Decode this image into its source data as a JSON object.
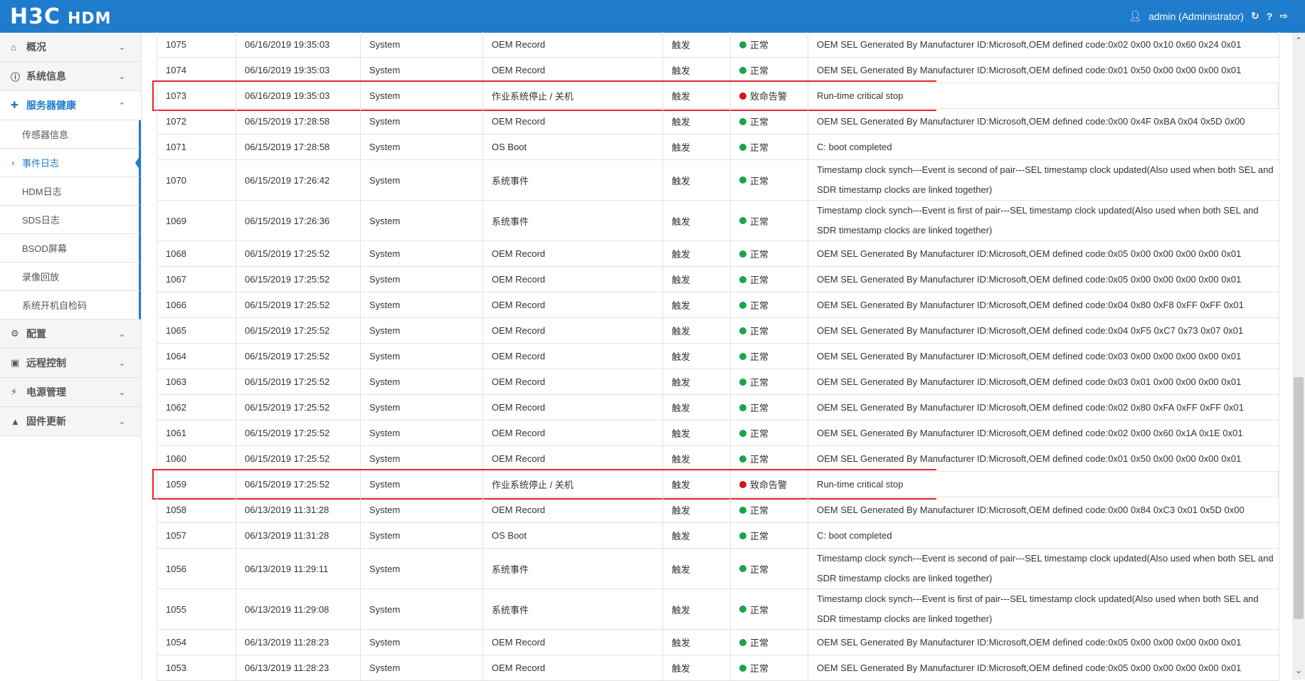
{
  "header": {
    "logo": "H3C",
    "product": "HDM",
    "user": "admin (Administrator)"
  },
  "sidebar": {
    "groups_top": [
      {
        "label": "概况",
        "icon": "home-icon"
      },
      {
        "label": "系统信息",
        "icon": "info-icon"
      }
    ],
    "open_group": {
      "label": "服务器健康",
      "icon": "health-icon"
    },
    "sub_items": [
      {
        "label": "传感器信息"
      },
      {
        "label": "事件日志",
        "active": true
      },
      {
        "label": "HDM日志"
      },
      {
        "label": "SDS日志"
      },
      {
        "label": "BSOD屏幕"
      },
      {
        "label": "录像回放"
      },
      {
        "label": "系统开机自检码"
      }
    ],
    "groups_bottom": [
      {
        "label": "配置",
        "icon": "gear-icon"
      },
      {
        "label": "远程控制",
        "icon": "remote-icon"
      },
      {
        "label": "电源管理",
        "icon": "power-icon"
      },
      {
        "label": "固件更新",
        "icon": "firmware-icon"
      }
    ]
  },
  "colors": {
    "normal": "#1aa34a",
    "critical": "#d0141a",
    "accent": "#1f7bcb"
  },
  "events": [
    {
      "id": "1075",
      "time": "06/16/2019 19:35:03",
      "type": "System",
      "sensor": "OEM Record",
      "trigger": "触发",
      "status": "正常",
      "level": "normal",
      "desc": "OEM SEL Generated By Manufacturer ID:Microsoft,OEM defined code:0x02 0x00 0x10 0x60 0x24 0x01"
    },
    {
      "id": "1074",
      "time": "06/16/2019 19:35:03",
      "type": "System",
      "sensor": "OEM Record",
      "trigger": "触发",
      "status": "正常",
      "level": "normal",
      "desc": "OEM SEL Generated By Manufacturer ID:Microsoft,OEM defined code:0x01 0x50 0x00 0x00 0x00 0x01"
    },
    {
      "id": "1073",
      "time": "06/16/2019 19:35:03",
      "type": "System",
      "sensor": "作业系统停止 / 关机",
      "trigger": "触发",
      "status": "致命告警",
      "level": "critical",
      "desc": "Run-time critical stop",
      "highlight": true
    },
    {
      "id": "1072",
      "time": "06/15/2019 17:28:58",
      "type": "System",
      "sensor": "OEM Record",
      "trigger": "触发",
      "status": "正常",
      "level": "normal",
      "desc": "OEM SEL Generated By Manufacturer ID:Microsoft,OEM defined code:0x00 0x4F 0xBA 0x04 0x5D 0x00"
    },
    {
      "id": "1071",
      "time": "06/15/2019 17:28:58",
      "type": "System",
      "sensor": "OS Boot",
      "trigger": "触发",
      "status": "正常",
      "level": "normal",
      "desc": "C: boot completed"
    },
    {
      "id": "1070",
      "time": "06/15/2019 17:26:42",
      "type": "System",
      "sensor": "系统事件",
      "trigger": "触发",
      "status": "正常",
      "level": "normal",
      "desc": "Timestamp clock synch---Event is second of pair---SEL timestamp clock updated(Also used when both SEL and SDR timestamp clocks are linked together)",
      "tall": true
    },
    {
      "id": "1069",
      "time": "06/15/2019 17:26:36",
      "type": "System",
      "sensor": "系统事件",
      "trigger": "触发",
      "status": "正常",
      "level": "normal",
      "desc": "Timestamp clock synch---Event is first of pair---SEL timestamp clock updated(Also used when both SEL and SDR timestamp clocks are linked together)",
      "tall": true
    },
    {
      "id": "1068",
      "time": "06/15/2019 17:25:52",
      "type": "System",
      "sensor": "OEM Record",
      "trigger": "触发",
      "status": "正常",
      "level": "normal",
      "desc": "OEM SEL Generated By Manufacturer ID:Microsoft,OEM defined code:0x05 0x00 0x00 0x00 0x00 0x01"
    },
    {
      "id": "1067",
      "time": "06/15/2019 17:25:52",
      "type": "System",
      "sensor": "OEM Record",
      "trigger": "触发",
      "status": "正常",
      "level": "normal",
      "desc": "OEM SEL Generated By Manufacturer ID:Microsoft,OEM defined code:0x05 0x00 0x00 0x00 0x00 0x01"
    },
    {
      "id": "1066",
      "time": "06/15/2019 17:25:52",
      "type": "System",
      "sensor": "OEM Record",
      "trigger": "触发",
      "status": "正常",
      "level": "normal",
      "desc": "OEM SEL Generated By Manufacturer ID:Microsoft,OEM defined code:0x04 0x80 0xF8 0xFF 0xFF 0x01"
    },
    {
      "id": "1065",
      "time": "06/15/2019 17:25:52",
      "type": "System",
      "sensor": "OEM Record",
      "trigger": "触发",
      "status": "正常",
      "level": "normal",
      "desc": "OEM SEL Generated By Manufacturer ID:Microsoft,OEM defined code:0x04 0xF5 0xC7 0x73 0x07 0x01"
    },
    {
      "id": "1064",
      "time": "06/15/2019 17:25:52",
      "type": "System",
      "sensor": "OEM Record",
      "trigger": "触发",
      "status": "正常",
      "level": "normal",
      "desc": "OEM SEL Generated By Manufacturer ID:Microsoft,OEM defined code:0x03 0x00 0x00 0x00 0x00 0x01"
    },
    {
      "id": "1063",
      "time": "06/15/2019 17:25:52",
      "type": "System",
      "sensor": "OEM Record",
      "trigger": "触发",
      "status": "正常",
      "level": "normal",
      "desc": "OEM SEL Generated By Manufacturer ID:Microsoft,OEM defined code:0x03 0x01 0x00 0x00 0x00 0x01"
    },
    {
      "id": "1062",
      "time": "06/15/2019 17:25:52",
      "type": "System",
      "sensor": "OEM Record",
      "trigger": "触发",
      "status": "正常",
      "level": "normal",
      "desc": "OEM SEL Generated By Manufacturer ID:Microsoft,OEM defined code:0x02 0x80 0xFA 0xFF 0xFF 0x01"
    },
    {
      "id": "1061",
      "time": "06/15/2019 17:25:52",
      "type": "System",
      "sensor": "OEM Record",
      "trigger": "触发",
      "status": "正常",
      "level": "normal",
      "desc": "OEM SEL Generated By Manufacturer ID:Microsoft,OEM defined code:0x02 0x00 0x60 0x1A 0x1E 0x01"
    },
    {
      "id": "1060",
      "time": "06/15/2019 17:25:52",
      "type": "System",
      "sensor": "OEM Record",
      "trigger": "触发",
      "status": "正常",
      "level": "normal",
      "desc": "OEM SEL Generated By Manufacturer ID:Microsoft,OEM defined code:0x01 0x50 0x00 0x00 0x00 0x01"
    },
    {
      "id": "1059",
      "time": "06/15/2019 17:25:52",
      "type": "System",
      "sensor": "作业系统停止 / 关机",
      "trigger": "触发",
      "status": "致命告警",
      "level": "critical",
      "desc": "Run-time critical stop",
      "highlight": true
    },
    {
      "id": "1058",
      "time": "06/13/2019 11:31:28",
      "type": "System",
      "sensor": "OEM Record",
      "trigger": "触发",
      "status": "正常",
      "level": "normal",
      "desc": "OEM SEL Generated By Manufacturer ID:Microsoft,OEM defined code:0x00 0x84 0xC3 0x01 0x5D 0x00"
    },
    {
      "id": "1057",
      "time": "06/13/2019 11:31:28",
      "type": "System",
      "sensor": "OS Boot",
      "trigger": "触发",
      "status": "正常",
      "level": "normal",
      "desc": "C: boot completed"
    },
    {
      "id": "1056",
      "time": "06/13/2019 11:29:11",
      "type": "System",
      "sensor": "系统事件",
      "trigger": "触发",
      "status": "正常",
      "level": "normal",
      "desc": "Timestamp clock synch---Event is second of pair---SEL timestamp clock updated(Also used when both SEL and SDR timestamp clocks are linked together)",
      "tall": true
    },
    {
      "id": "1055",
      "time": "06/13/2019 11:29:08",
      "type": "System",
      "sensor": "系统事件",
      "trigger": "触发",
      "status": "正常",
      "level": "normal",
      "desc": "Timestamp clock synch---Event is first of pair---SEL timestamp clock updated(Also used when both SEL and SDR timestamp clocks are linked together)",
      "tall": true
    },
    {
      "id": "1054",
      "time": "06/13/2019 11:28:23",
      "type": "System",
      "sensor": "OEM Record",
      "trigger": "触发",
      "status": "正常",
      "level": "normal",
      "desc": "OEM SEL Generated By Manufacturer ID:Microsoft,OEM defined code:0x05 0x00 0x00 0x00 0x00 0x01"
    },
    {
      "id": "1053",
      "time": "06/13/2019 11:28:23",
      "type": "System",
      "sensor": "OEM Record",
      "trigger": "触发",
      "status": "正常",
      "level": "normal",
      "desc": "OEM SEL Generated By Manufacturer ID:Microsoft,OEM defined code:0x05 0x00 0x00 0x00 0x00 0x01"
    }
  ]
}
